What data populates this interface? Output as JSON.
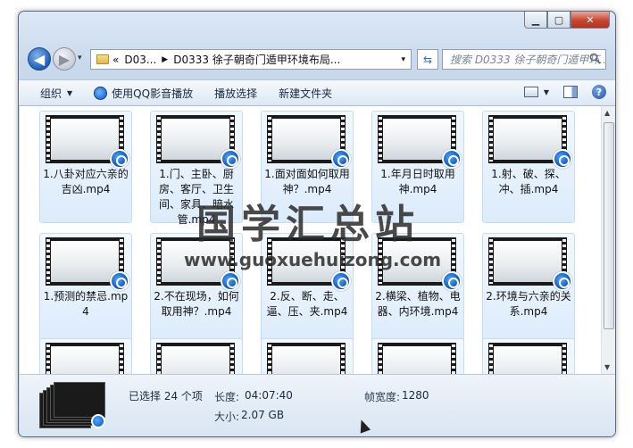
{
  "window": {
    "caption_buttons": {
      "minimize": "▁",
      "maximize": "▢",
      "close": "✕"
    }
  },
  "navbar": {
    "back_glyph": "◀",
    "forward_glyph": "▶",
    "history_drop": "▾",
    "address": {
      "overflow": "«",
      "segments": [
        "D03...",
        "D0333 徐子朝奇门遁甲环境布局..."
      ],
      "separator": "▶",
      "drop": "▾"
    },
    "refresh_glyph": "⇆",
    "search_placeholder": "搜索 D0333 徐子朝奇门遁甲环..."
  },
  "toolbar": {
    "organize": "组织",
    "play_qq": "使用QQ影音播放",
    "play_select": "播放选择",
    "new_folder": "新建文件夹",
    "arrow": "▼",
    "help": "?"
  },
  "files": [
    {
      "label": "1.八卦对应六亲的吉凶.mp4"
    },
    {
      "label": "1.门、主卧、厨房、客厅、卫生间、家具、暗水管.mp4"
    },
    {
      "label": "1.面对面如何取用神？.mp4"
    },
    {
      "label": "1.年月日时取用神.mp4"
    },
    {
      "label": "1.射、破、探、冲、插.mp4"
    },
    {
      "label": "1.预测的禁忌.mp4"
    },
    {
      "label": "2.不在现场，如何取用神？.mp4"
    },
    {
      "label": "2.反、断、走、逼、压、夹.mp4"
    },
    {
      "label": "2.横梁、植物、电器、内环境.mp4"
    },
    {
      "label": "2.环境与六亲的关系.mp4"
    },
    {
      "label": ""
    },
    {
      "label": ""
    },
    {
      "label": ""
    },
    {
      "label": ""
    },
    {
      "label": ""
    }
  ],
  "watermark": {
    "chinese": "国学汇总站",
    "url": "www.guoxuehuizong.com"
  },
  "scrollbar": {
    "up": "▲",
    "down": "▼"
  },
  "status": {
    "selected": "已选择 24 个项",
    "duration_label": "长度:",
    "duration": "04:07:40",
    "size_label": "大小:",
    "size": "2.07 GB",
    "frame_width_label": "帧宽度:",
    "frame_width": "1280"
  }
}
